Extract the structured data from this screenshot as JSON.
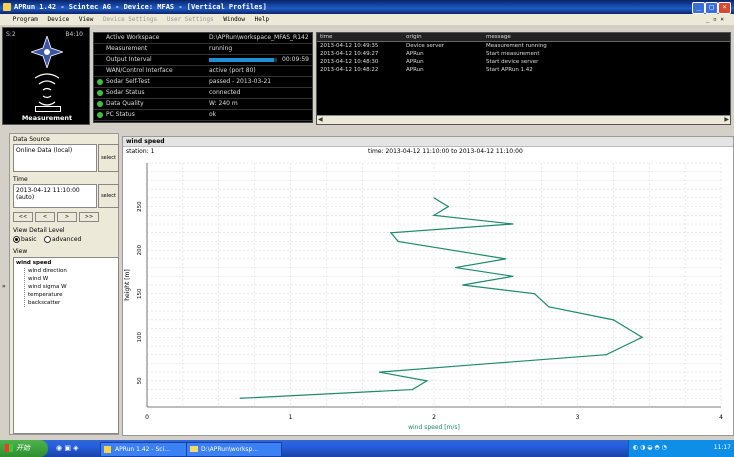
{
  "window": {
    "title": "APRun 1.42 - Scintec AG - Device: MFAS - [Vertical Profiles]"
  },
  "menu": [
    "Program",
    "Device",
    "View",
    "Device Settings",
    "User Settings",
    "Window",
    "Help"
  ],
  "measurement_panel": {
    "left_label": "S:2",
    "right_label": "B4:10",
    "label": "Measurement"
  },
  "status": {
    "rows": [
      {
        "key": "Active Workspace",
        "value": "D:\\APRun\\workspace_MFAS_R142"
      },
      {
        "key": "Measurement",
        "value": "running"
      },
      {
        "key": "Output Interval",
        "value": "00:09:59"
      },
      {
        "key": "WAN/Control Interface",
        "value": "active (port 80)"
      },
      {
        "key": "Sodar Self-Test",
        "value": "passed - 2013-03-21"
      },
      {
        "key": "Sodar Status",
        "value": "connected"
      },
      {
        "key": "Data Quality",
        "value": "W: 240 m"
      },
      {
        "key": "PC Status",
        "value": "ok"
      }
    ],
    "output_progress": 0.95
  },
  "messages": {
    "headers": [
      "time",
      "origin",
      "message"
    ],
    "rows": [
      [
        "2013-04-12 10:49:35",
        "Device server",
        "Measurement running"
      ],
      [
        "2013-04-12 10:49:27",
        "APRun",
        "Start measurement"
      ],
      [
        "2013-04-12 10:48:30",
        "APRun",
        "Start device server"
      ],
      [
        "2013-04-12 10:48:22",
        "APRun",
        "Start APRun 1.42"
      ]
    ]
  },
  "sidebar": {
    "data_source_label": "Data Source",
    "data_source_value": "Online Data (local)",
    "select_label": "select",
    "time_label": "Time",
    "time_value": "2013-04-12 11:10:00 (auto)",
    "nav_buttons": [
      "<<",
      "<",
      ">",
      ">>"
    ],
    "view_detail_label": "View Detail Level",
    "detail_options": [
      "basic",
      "advanced"
    ],
    "view_label": "View",
    "tree": [
      "wind speed",
      "wind direction",
      "wind W",
      "wind sigma W",
      "temperature",
      "backscatter"
    ]
  },
  "chart_panel": {
    "title": "wind speed",
    "station": "station: 1",
    "time_range": "time: 2013-04-12 11:10:00 to 2013-04-12 11:10:00"
  },
  "chart_data": {
    "type": "line",
    "xlabel": "wind speed [m/s]",
    "ylabel": "height [m]",
    "xlim": [
      0,
      4
    ],
    "ylim": [
      20,
      300
    ],
    "xticks": [
      0,
      1,
      2,
      3,
      4
    ],
    "yticks": [
      50,
      100,
      150,
      200,
      250
    ],
    "grid": true,
    "series": [
      {
        "color": "#1e8a6e",
        "points": [
          [
            0.65,
            30
          ],
          [
            1.85,
            40
          ],
          [
            1.95,
            50
          ],
          [
            1.62,
            60
          ],
          [
            2.4,
            70
          ],
          [
            3.2,
            80
          ],
          [
            3.45,
            100
          ],
          [
            3.25,
            120
          ],
          [
            2.8,
            135
          ],
          [
            2.7,
            150
          ],
          [
            2.2,
            160
          ],
          [
            2.55,
            170
          ],
          [
            2.15,
            180
          ],
          [
            2.5,
            190
          ],
          [
            1.75,
            210
          ],
          [
            1.7,
            220
          ],
          [
            2.55,
            230
          ],
          [
            2.0,
            240
          ],
          [
            2.1,
            250
          ],
          [
            2.0,
            260
          ]
        ]
      }
    ]
  },
  "taskbar": {
    "start_label": "开始",
    "tasks": [
      "APRun 1.42 - Sci...",
      "D:\\APRun\\worksp..."
    ],
    "clock": "11:17"
  },
  "colors": {
    "titlebar": "#0a246a",
    "line": "#1e8a6e",
    "taskbar": "#245edc"
  }
}
